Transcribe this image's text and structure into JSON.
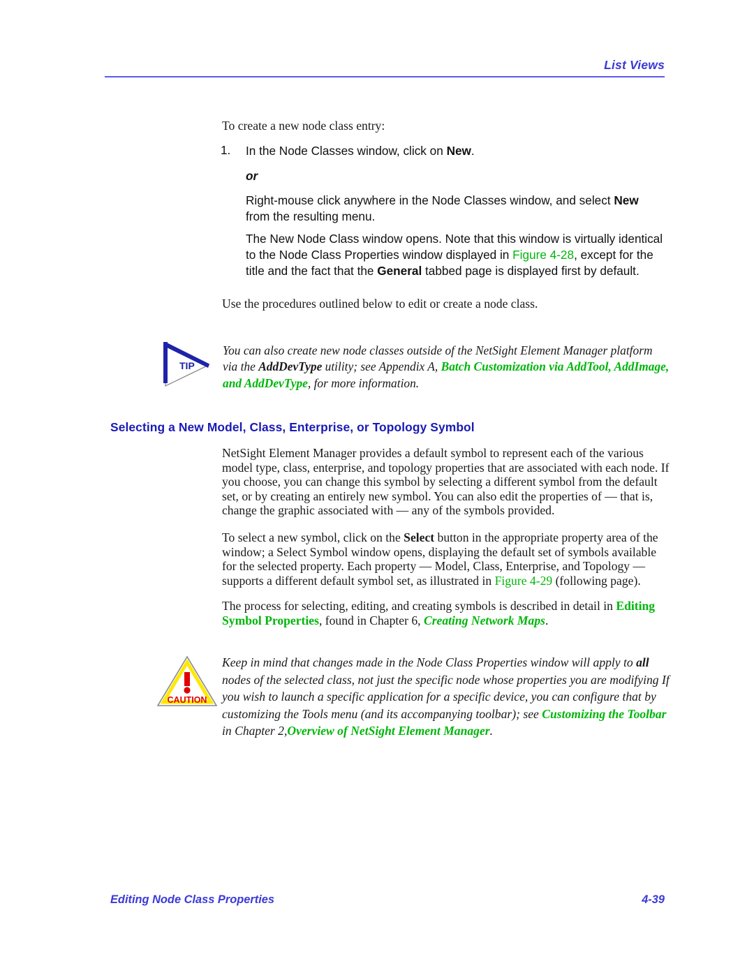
{
  "header": {
    "running_head": "List Views"
  },
  "body": {
    "intro_line": "To create a new node class entry:",
    "steps": [
      {
        "number": "1.",
        "text_before": "In the Node Classes window, click on ",
        "bold": "New",
        "text_after": "."
      }
    ],
    "or_label": "or",
    "alt_step": {
      "text_before": "Right-mouse click anywhere in the Node Classes window, and select ",
      "bold": "New",
      "text_after": " from the resulting menu."
    },
    "note_step": {
      "part1": "The New Node Class window opens. Note that this window is virtually identical to the Node Class Properties window displayed in ",
      "link": "Figure 4-28",
      "part2": ", except for the title and the fact that the ",
      "bold": "General",
      "part3": " tabbed page is displayed first by default."
    },
    "use_procedures": "Use the procedures outlined below to edit or create a node class."
  },
  "tip": {
    "icon_label": "TIP",
    "part1": "You can also create new node classes outside of the NetSight Element Manager platform via the ",
    "bold1": "AddDevType",
    "part2": " utility; see Appendix A, ",
    "link1": "Batch Customization via AddTool, AddImage, and AddDevType",
    "part3": ", for more information."
  },
  "section": {
    "heading": "Selecting a New Model, Class, Enterprise, or Topology Symbol",
    "intro_paragraph": "NetSight Element Manager provides a default symbol to represent each of the various model type, class, enterprise, and topology properties that are associated with each node. If you choose, you can change this symbol by selecting a different symbol from the default set, or by creating an entirely new symbol. You can also edit the properties of — that is, change the graphic associated with — any of the symbols provided.",
    "select_paragraph": {
      "part1": "To select a new symbol, click on the ",
      "bold1": "Select",
      "part2": " button in the appropriate property area of the window; a Select Symbol window opens, displaying the default set of symbols available for the selected property. Each property — Model, Class, Enterprise, and Topology — supports a different default symbol set, as illustrated in ",
      "link1": "Figure 4-29",
      "part3": " (following page)."
    },
    "process_paragraph": {
      "part1": "The process for selecting, editing, and creating symbols is described in detail in ",
      "link1": "Editing Symbol Properties",
      "part2": ", found in Chapter 6, ",
      "link2": "Creating Network Maps",
      "part3": "."
    }
  },
  "caution": {
    "icon_label": "CAUTION",
    "part1": "Keep in mind that changes made in the Node Class Properties window will apply to ",
    "bold1": "all",
    "part2": " nodes of the selected class, not just the specific node whose properties you are modifying If you wish to launch a specific application for a specific device, you can configure that by customizing the Tools menu (and its accompanying toolbar); see ",
    "link1": "Customizing the Toolbar",
    "part3": " in Chapter 2,",
    "link2": "Overview of NetSight Element Manager",
    "part4": "."
  },
  "footer": {
    "left": "Editing Node Class Properties",
    "page_number": "4-39"
  },
  "colors": {
    "header_blue": "#3a3ad6",
    "rule_blue": "#5a5aee",
    "heading_blue": "#1a1ab5",
    "link_green": "#00b60b",
    "caution_red": "#e00000",
    "caution_yellow": "#ffe800",
    "tip_blue": "#1f23a8"
  }
}
